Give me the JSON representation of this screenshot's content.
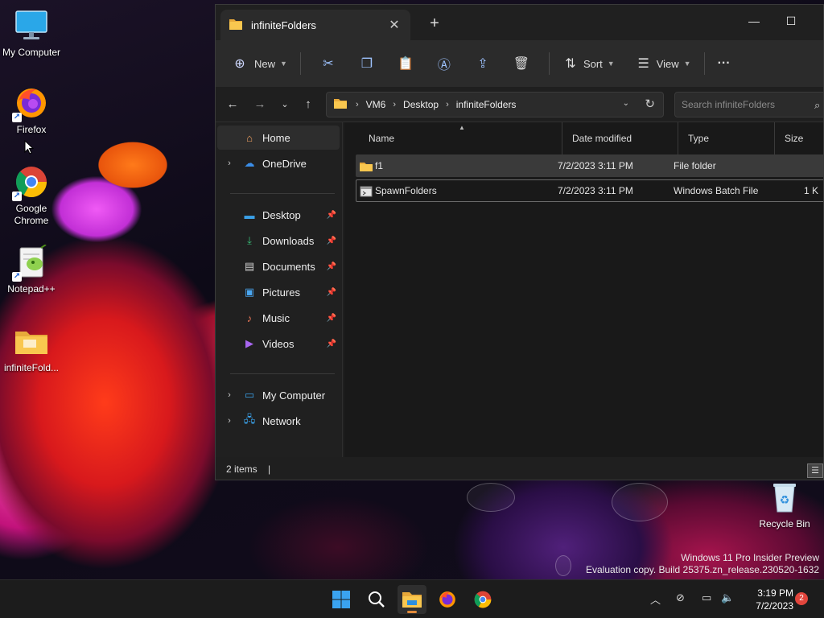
{
  "desktop": {
    "icons": [
      {
        "label": "My Computer"
      },
      {
        "label": "Firefox"
      },
      {
        "label": "Google Chrome"
      },
      {
        "label": "Notepad++"
      },
      {
        "label": "infiniteFold..."
      }
    ],
    "recycle_bin": "Recycle Bin",
    "watermark_line1": "Windows 11 Pro Insider Preview",
    "watermark_line2": "Evaluation copy. Build 25375.zn_release.230520-1632"
  },
  "window": {
    "tab_title": "infiniteFolders",
    "toolbar": {
      "new_label": "New",
      "sort_label": "Sort",
      "view_label": "View",
      "more_label": "···"
    },
    "breadcrumb": [
      "VM6",
      "Desktop",
      "infiniteFolders"
    ],
    "search_placeholder": "Search infiniteFolders",
    "nav": {
      "home": "Home",
      "onedrive": "OneDrive",
      "desktop": "Desktop",
      "downloads": "Downloads",
      "documents": "Documents",
      "pictures": "Pictures",
      "music": "Music",
      "videos": "Videos",
      "my_computer": "My Computer",
      "network": "Network"
    },
    "columns": {
      "name": "Name",
      "date": "Date modified",
      "type": "Type",
      "size": "Size"
    },
    "rows": [
      {
        "name": "f1",
        "date": "7/2/2023 3:11 PM",
        "type": "File folder",
        "size": ""
      },
      {
        "name": "SpawnFolders",
        "date": "7/2/2023 3:11 PM",
        "type": "Windows Batch File",
        "size": "1 K"
      }
    ],
    "status": "2 items",
    "status_caret": "|"
  },
  "taskbar": {
    "time": "3:19 PM",
    "date": "7/2/2023",
    "notifications": "2"
  }
}
